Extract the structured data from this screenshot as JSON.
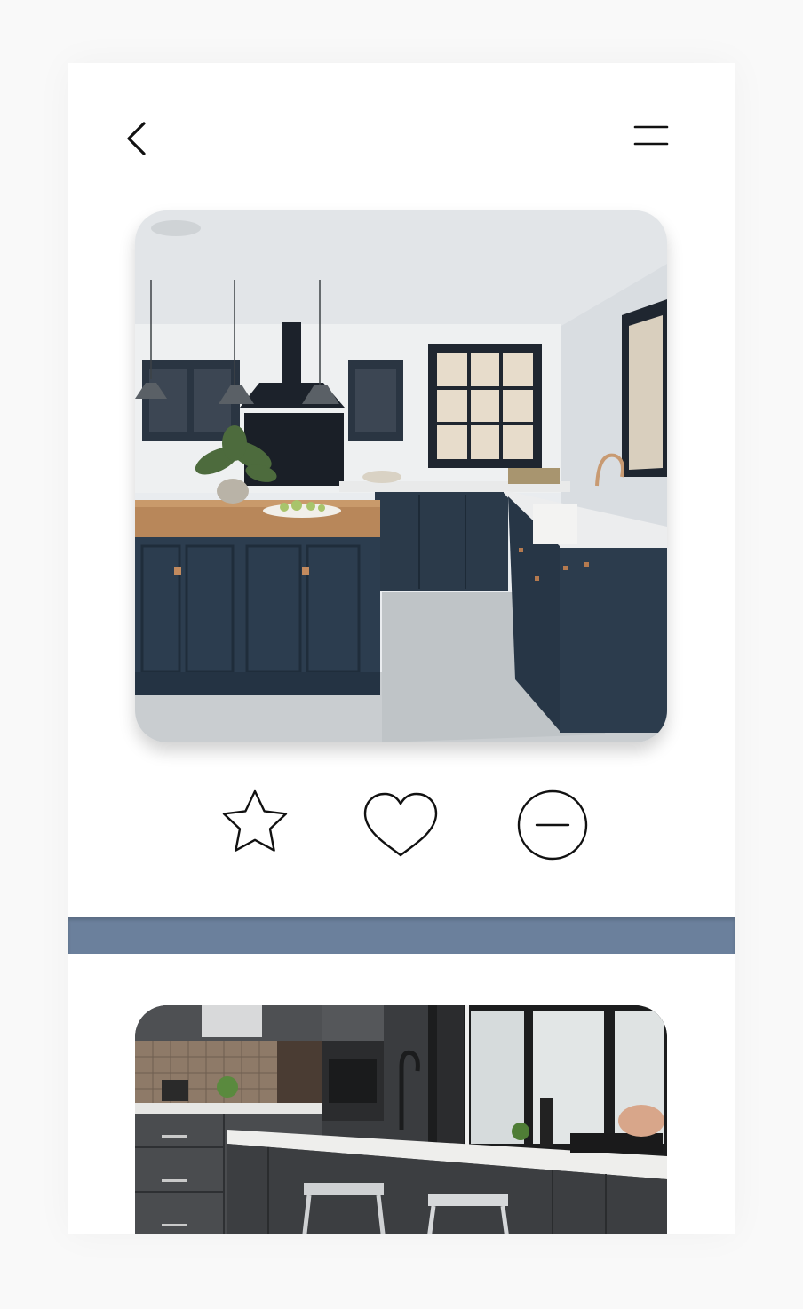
{
  "header": {
    "back_icon": "chevron-left-icon",
    "menu_icon": "hamburger-menu-icon"
  },
  "cards": [
    {
      "image": "navy-shaker-kitchen-with-wood-island-photo"
    },
    {
      "image": "dark-gray-modern-kitchen-with-stools-photo"
    }
  ],
  "actions": {
    "favorite_icon": "star-outline-icon",
    "like_icon": "heart-outline-icon",
    "dismiss_icon": "minus-circle-icon"
  },
  "colors": {
    "background": "#ffffff",
    "page": "#f9f9f9",
    "divider_band": "#6b809c",
    "icon_stroke": "#111111"
  }
}
